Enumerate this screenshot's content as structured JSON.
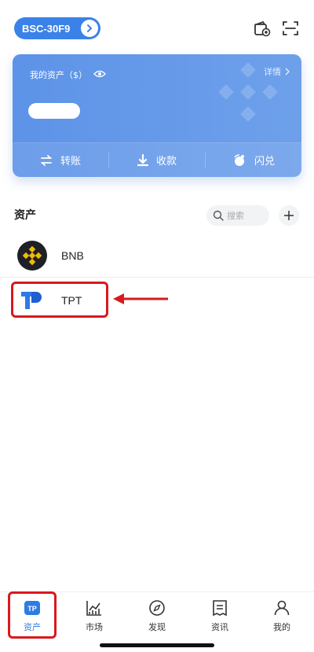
{
  "header": {
    "wallet_name": "BSC-30F9"
  },
  "asset_card": {
    "label": "我的资产（$）",
    "detail_label": "详情",
    "actions": [
      {
        "label": "转账",
        "icon": "transfer-icon"
      },
      {
        "label": "收款",
        "icon": "receive-icon"
      },
      {
        "label": "闪兑",
        "icon": "swap-icon"
      }
    ]
  },
  "assets": {
    "title": "资产",
    "search_placeholder": "搜索",
    "tokens": [
      {
        "symbol": "BNB",
        "icon": "bnb-logo"
      },
      {
        "symbol": "TPT",
        "icon": "tpt-logo"
      }
    ]
  },
  "bottom_nav": {
    "items": [
      {
        "label": "资产",
        "icon": "wallet-tp-icon",
        "active": true
      },
      {
        "label": "市场",
        "icon": "market-chart-icon",
        "active": false
      },
      {
        "label": "发现",
        "icon": "compass-icon",
        "active": false
      },
      {
        "label": "资讯",
        "icon": "news-icon",
        "active": false
      },
      {
        "label": "我的",
        "icon": "profile-icon",
        "active": false
      }
    ]
  },
  "colors": {
    "accent": "#3b82e8",
    "card_gradient_start": "#5d93e8",
    "highlight": "#d8191e",
    "bnb_bg": "#1e2026",
    "bnb_gold": "#f0b90b",
    "tpt_blue": "#2f7be6"
  }
}
